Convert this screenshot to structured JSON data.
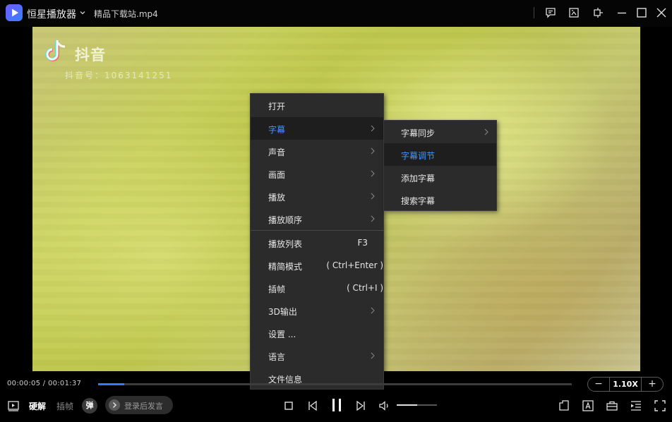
{
  "titlebar": {
    "app_name": "恒星播放器",
    "file_name": "精品下载站.mp4"
  },
  "video": {
    "watermark_brand": "抖音",
    "watermark_id": "抖音号：1063141251"
  },
  "context_menu": {
    "items": [
      {
        "label": "打开"
      },
      {
        "label": "字幕"
      },
      {
        "label": "声音"
      },
      {
        "label": "画面"
      },
      {
        "label": "播放"
      },
      {
        "label": "播放顺序"
      },
      {
        "label": "播放列表",
        "shortcut": "F3"
      },
      {
        "label": "精简模式",
        "shortcut": "( Ctrl+Enter )"
      },
      {
        "label": "插帧",
        "shortcut": "( Ctrl+I )"
      },
      {
        "label": "3D输出"
      },
      {
        "label": "设置 ..."
      },
      {
        "label": "语言"
      },
      {
        "label": "文件信息"
      }
    ]
  },
  "subtitle_submenu": {
    "items": [
      {
        "label": "字幕同步"
      },
      {
        "label": "字幕调节"
      },
      {
        "label": "添加字幕"
      },
      {
        "label": "搜索字幕"
      }
    ]
  },
  "controls": {
    "time": "00:00:05 / 00:01:37",
    "progress_fraction": 0.055,
    "speed": "1.10X",
    "speed_minus": "−",
    "speed_plus": "+",
    "hw_decode": "硬解",
    "frame_interp": "插帧",
    "danmu": "弹",
    "comment_placeholder": "登录后发言",
    "volume_fraction": 0.5
  },
  "colors": {
    "accent": "#4a90ff",
    "progress": "#2f7bff",
    "menu_bg": "#2b2b2b"
  }
}
